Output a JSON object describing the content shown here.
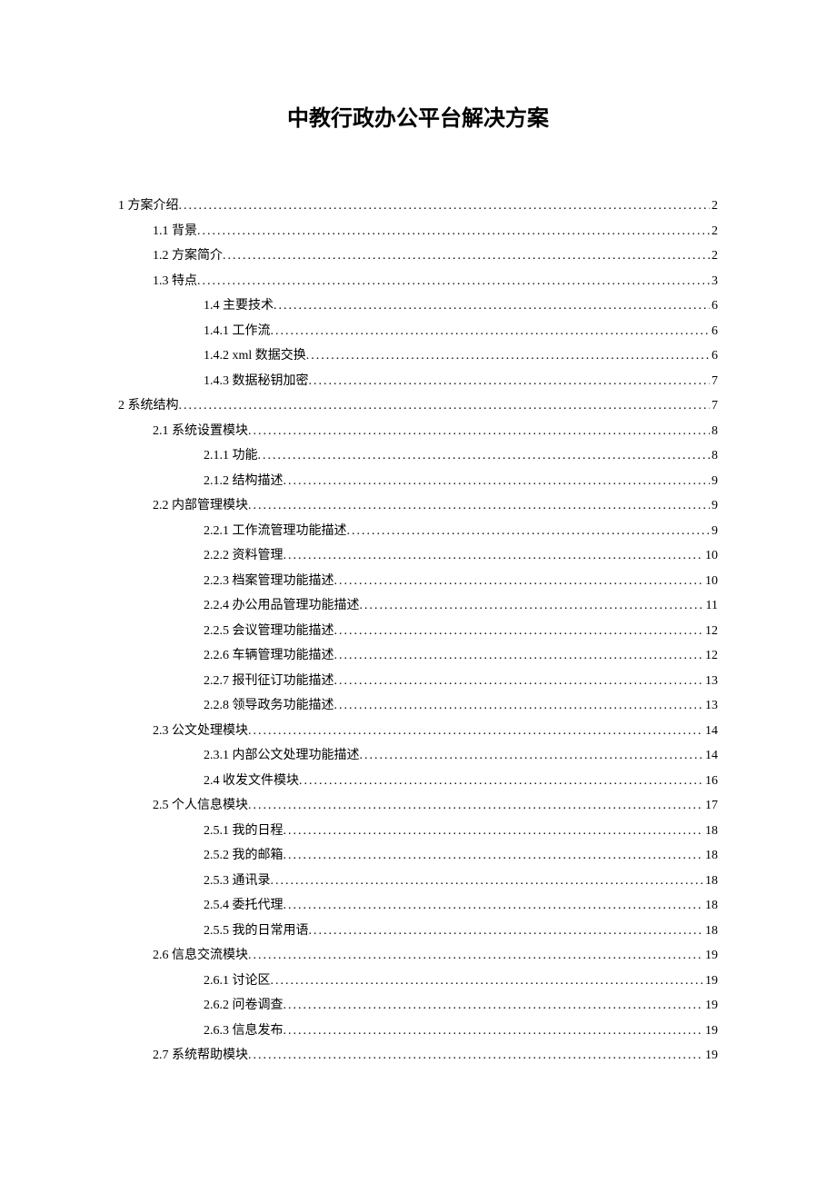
{
  "title": "中教行政办公平台解决方案",
  "toc": [
    {
      "indent": 0,
      "label": "1 方案介绍",
      "page": "2"
    },
    {
      "indent": 1,
      "label": "1.1 背景",
      "page": "2"
    },
    {
      "indent": 1,
      "label": "1.2 方案简介",
      "page": "2"
    },
    {
      "indent": 1,
      "label": "1.3 特点",
      "page": "3"
    },
    {
      "indent": 2,
      "label": "1.4  主要技术",
      "page": "6"
    },
    {
      "indent": 2,
      "label": "1.4.1  工作流",
      "page": "6"
    },
    {
      "indent": 2,
      "label": "1.4.2 xml  数据交换 ",
      "page": "6"
    },
    {
      "indent": 2,
      "label": "1.4.3 数据秘钥加密",
      "page": "7"
    },
    {
      "indent": 0,
      "label": "2 系统结构",
      "page": "7"
    },
    {
      "indent": 1,
      "label": "2.1 系统设置模块",
      "page": "8"
    },
    {
      "indent": 2,
      "label": "2.1.1 功能",
      "page": "8"
    },
    {
      "indent": 2,
      "label": "2.1.2  结构描述",
      "page": "9"
    },
    {
      "indent": 1,
      "label": "2.2 内部管理模块",
      "page": "9"
    },
    {
      "indent": 2,
      "label": "2.2.1 工作流管理功能描述",
      "page": "9"
    },
    {
      "indent": 2,
      "label": "2.2.2  资料管理",
      "page": "10"
    },
    {
      "indent": 2,
      "label": "2.2.3  档案管理功能描述",
      "page": "10"
    },
    {
      "indent": 2,
      "label": "2.2.4  办公用品管理功能描述",
      "page": "11"
    },
    {
      "indent": 2,
      "label": "2.2.5  会议管理功能描述",
      "page": "12"
    },
    {
      "indent": 2,
      "label": "2.2.6  车辆管理功能描述",
      "page": "12"
    },
    {
      "indent": 2,
      "label": "2.2.7  报刊征订功能描述",
      "page": "13"
    },
    {
      "indent": 2,
      "label": "2.2.8  领导政务功能描述",
      "page": "13"
    },
    {
      "indent": 1,
      "label": "2.3 公文处理模块",
      "page": "14"
    },
    {
      "indent": 2,
      "label": "2.3.1 内部公文处理功能描述",
      "page": "14"
    },
    {
      "indent": 2,
      "label": "2.4 收发文件模块",
      "page": "16"
    },
    {
      "indent": 1,
      "label": "2.5 个人信息模块",
      "page": "17"
    },
    {
      "indent": 2,
      "label": "2.5.1  我的日程",
      "page": "18"
    },
    {
      "indent": 2,
      "label": "2.5.2  我的邮箱",
      "page": "18"
    },
    {
      "indent": 2,
      "label": "2.5.3  通讯录",
      "page": "18"
    },
    {
      "indent": 2,
      "label": "2.5.4  委托代理",
      "page": "18"
    },
    {
      "indent": 2,
      "label": "2.5.5  我的日常用语",
      "page": "18"
    },
    {
      "indent": 1,
      "label": "2.6 信息交流模块",
      "page": "19"
    },
    {
      "indent": 2,
      "label": "2.6.1  讨论区",
      "page": "19"
    },
    {
      "indent": 2,
      "label": "2.6.2  问卷调查",
      "page": "19"
    },
    {
      "indent": 2,
      "label": "2.6.3  信息发布",
      "page": "19"
    },
    {
      "indent": 1,
      "label": "2.7  系统帮助模块",
      "page": "19"
    }
  ]
}
